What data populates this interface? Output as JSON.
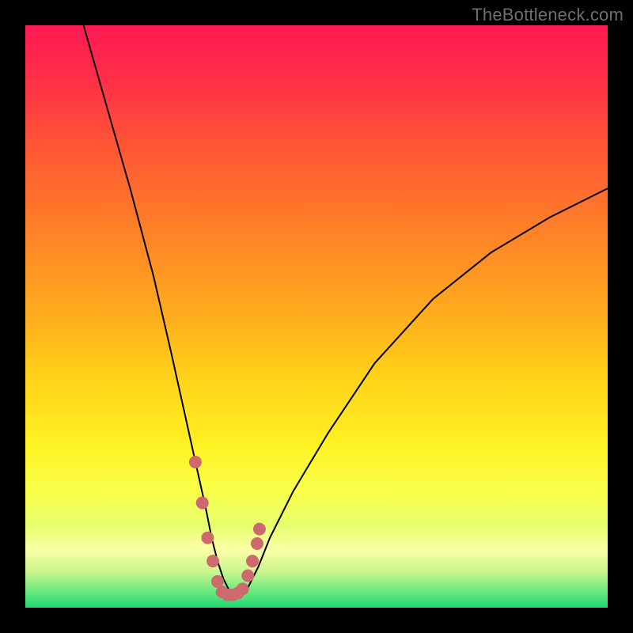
{
  "watermark": "TheBottleneck.com",
  "colors": {
    "marker": "#cd6a6e",
    "curve_stroke": "#000000"
  },
  "chart_data": {
    "type": "line",
    "title": "",
    "xlabel": "",
    "ylabel": "",
    "xlim": [
      0,
      100
    ],
    "ylim": [
      0,
      100
    ],
    "grid": false,
    "legend": false,
    "series": [
      {
        "name": "bottleneck-curve",
        "x": [
          10,
          14,
          18,
          22,
          25,
          27,
          29,
          31,
          32,
          33,
          34,
          35,
          36,
          37,
          38,
          39,
          40,
          42,
          46,
          52,
          60,
          70,
          80,
          90,
          100
        ],
        "values": [
          100,
          86,
          72,
          57,
          44,
          35,
          26,
          17,
          12,
          8,
          5,
          3,
          2,
          2,
          3,
          5,
          7,
          12,
          20,
          30,
          42,
          53,
          61,
          67,
          72
        ]
      }
    ],
    "highlight_x_range": [
      29,
      40
    ],
    "markers": [
      {
        "x": 29.2,
        "y": 25.0
      },
      {
        "x": 30.4,
        "y": 18.0
      },
      {
        "x": 31.3,
        "y": 12.0
      },
      {
        "x": 32.2,
        "y": 8.0
      },
      {
        "x": 33.0,
        "y": 4.5
      },
      {
        "x": 33.8,
        "y": 2.7
      },
      {
        "x": 34.7,
        "y": 2.2
      },
      {
        "x": 35.6,
        "y": 2.2
      },
      {
        "x": 36.5,
        "y": 2.5
      },
      {
        "x": 37.3,
        "y": 3.2
      },
      {
        "x": 38.2,
        "y": 5.5
      },
      {
        "x": 39.0,
        "y": 8.0
      },
      {
        "x": 39.8,
        "y": 11.0
      },
      {
        "x": 40.2,
        "y": 13.5
      }
    ],
    "marker_radius_px": 8
  }
}
